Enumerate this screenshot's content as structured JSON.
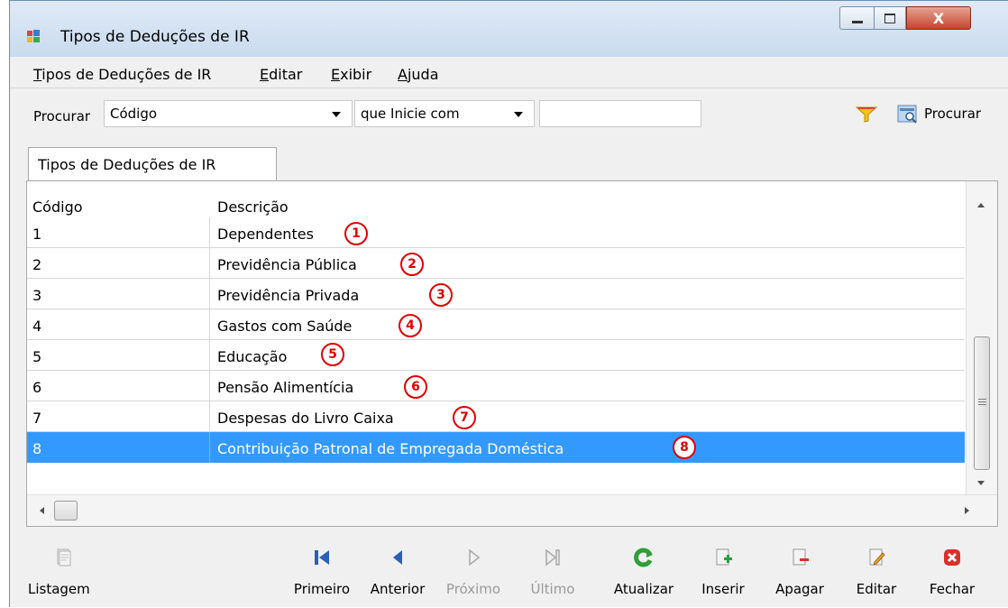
{
  "window": {
    "title": "Tipos de Deduções de IR",
    "close_glyph": "X"
  },
  "menu": [
    {
      "label": "Tipos de Deduções de IR"
    },
    {
      "label": "Editar"
    },
    {
      "label": "Exibir"
    },
    {
      "label": "Ajuda"
    }
  ],
  "search": {
    "label": "Procurar",
    "field_value": "Código",
    "condition_value": "que Inicie com",
    "text_value": "",
    "button_label": "Procurar"
  },
  "tab": {
    "label": "Tipos de Deduções de IR"
  },
  "grid": {
    "columns": [
      "Código",
      "Descrição"
    ],
    "rows": [
      {
        "code": "1",
        "desc": "Dependentes",
        "marker": "1"
      },
      {
        "code": "2",
        "desc": "Previdência Pública",
        "marker": "2"
      },
      {
        "code": "3",
        "desc": "Previdência Privada",
        "marker": "3"
      },
      {
        "code": "4",
        "desc": "Gastos com Saúde",
        "marker": "4"
      },
      {
        "code": "5",
        "desc": "Educação",
        "marker": "5"
      },
      {
        "code": "6",
        "desc": "Pensão Alimentícia",
        "marker": "6"
      },
      {
        "code": "7",
        "desc": "Despesas do Livro Caixa",
        "marker": "7"
      },
      {
        "code": "8",
        "desc": "Contribuição Patronal de Empregada Doméstica",
        "marker": "8"
      }
    ],
    "selected_row": 8,
    "selection_color": "#3399ff",
    "marker_color": "#e00000"
  },
  "toolbar": {
    "listagem": "Listagem",
    "primeiro": "Primeiro",
    "anterior": "Anterior",
    "proximo": "Próximo",
    "ultimo": "Último",
    "atualizar": "Atualizar",
    "inserir": "Inserir",
    "apagar": "Apagar",
    "editar": "Editar",
    "fechar": "Fechar"
  }
}
